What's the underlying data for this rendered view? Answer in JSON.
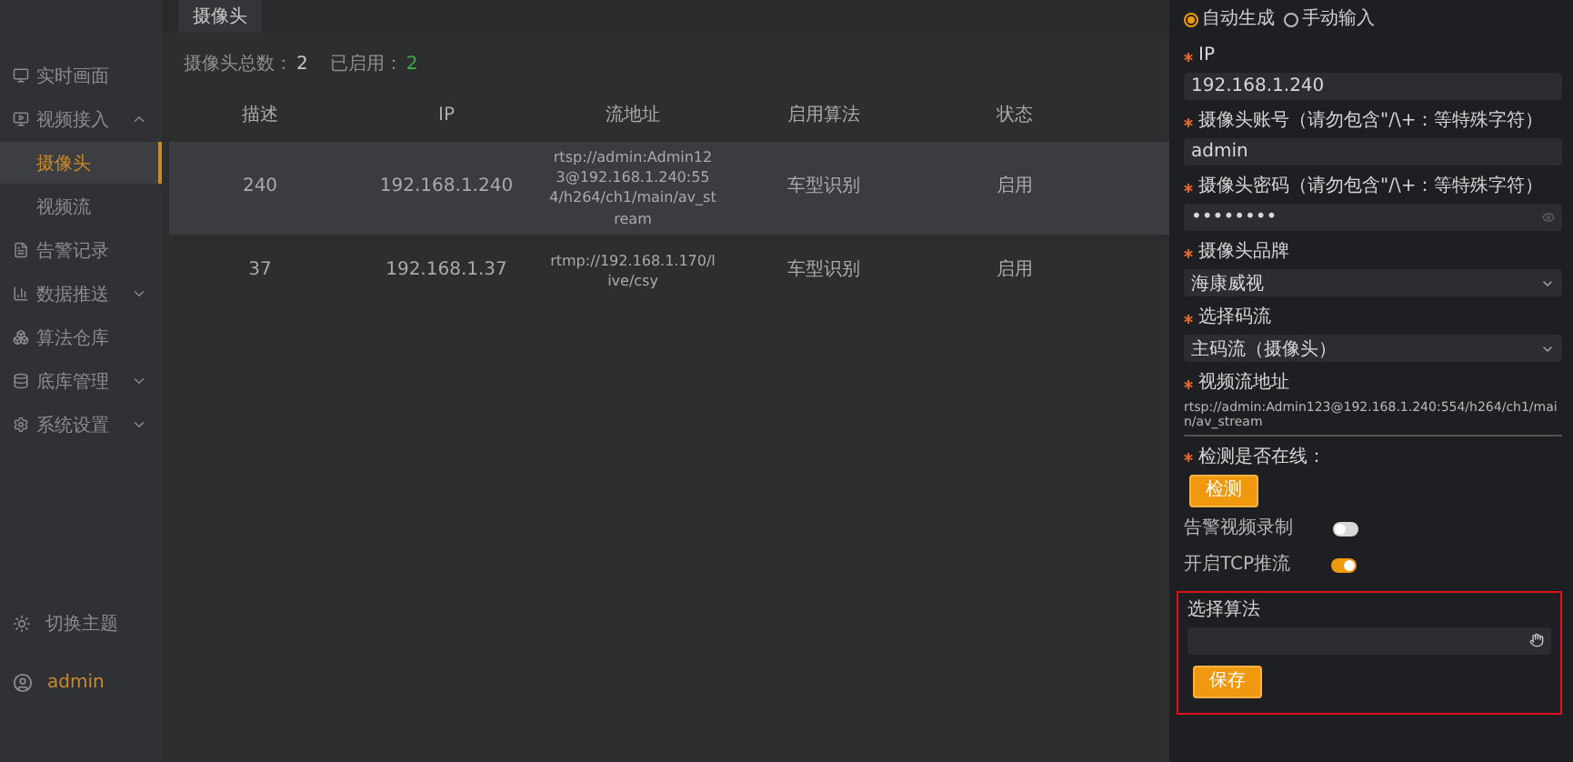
{
  "sidebar": {
    "items": [
      {
        "label": "实时画面",
        "selected": false
      },
      {
        "label": "视频接入",
        "selected": false,
        "expanded": true,
        "children": [
          {
            "label": "摄像头",
            "selected": true
          },
          {
            "label": "视频流",
            "selected": false
          }
        ]
      },
      {
        "label": "告警记录",
        "selected": false
      },
      {
        "label": "数据推送",
        "selected": false,
        "expanded": false
      },
      {
        "label": "算法仓库",
        "selected": false
      },
      {
        "label": "底库管理",
        "selected": false,
        "expanded": false
      },
      {
        "label": "系统设置",
        "selected": false,
        "expanded": false
      }
    ],
    "footer": [
      {
        "label": "切换主题",
        "kind": "theme"
      },
      {
        "label": "admin",
        "kind": "user"
      }
    ]
  },
  "tabs": [
    {
      "label": "摄像头",
      "selected": true
    }
  ],
  "summary": [
    {
      "label": "摄像头总数：",
      "value": "2",
      "kind": "total"
    },
    {
      "label": "已启用：",
      "value": "2",
      "kind": "enabled"
    }
  ],
  "table": {
    "columns": [
      "描述",
      "IP",
      "流地址",
      "启用算法",
      "状态"
    ],
    "rows": [
      {
        "selected": true,
        "cells": [
          "240",
          "192.168.1.240",
          "rtsp://admin:Admin123@192.168.1.240:554/h264/ch1/main/av_stream",
          "车型识别",
          "启用"
        ]
      },
      {
        "selected": false,
        "cells": [
          "37",
          "192.168.1.37",
          "rtmp://192.168.1.170/live/csy",
          "车型识别",
          "启用"
        ]
      }
    ]
  },
  "drawer": {
    "fields": [
      {
        "kind": "radio",
        "options": [
          {
            "label": "自动生成",
            "selected": true
          },
          {
            "label": "手动输入",
            "selected": false
          }
        ]
      },
      {
        "kind": "input",
        "label": "IP",
        "required": true,
        "value": "192.168.1.240"
      },
      {
        "kind": "input",
        "label": "摄像头账号（请勿包含\"/\\+：等特殊字符）",
        "required": true,
        "value": "admin"
      },
      {
        "kind": "password",
        "label": "摄像头密码（请勿包含\"/\\+：等特殊字符）",
        "required": true,
        "value": "••••••••"
      },
      {
        "kind": "select",
        "label": "摄像头品牌",
        "required": true,
        "value": "海康威视"
      },
      {
        "kind": "select",
        "label": "选择码流",
        "required": true,
        "value": "主码流（摄像头）"
      },
      {
        "kind": "url",
        "label": "视频流地址",
        "required": true,
        "value": "rtsp://admin:Admin123@192.168.1.240:554/h264/ch1/main/av_stream"
      },
      {
        "kind": "check",
        "label": "检测是否在线：",
        "required": true,
        "button": "检测"
      },
      {
        "kind": "switch",
        "label": "告警视频录制",
        "on": false
      },
      {
        "kind": "switch",
        "label": "开启TCP推流",
        "on": true
      }
    ],
    "highlighted_section": {
      "highlight": true,
      "label": "选择算法",
      "placeholder_empty": true,
      "button": "保存"
    }
  }
}
